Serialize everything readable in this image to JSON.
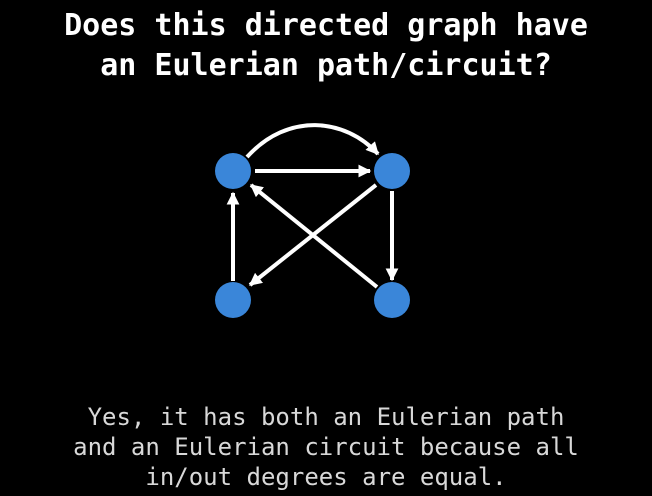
{
  "question": {
    "line1": "Does this directed graph have",
    "line2": "an Eulerian path/circuit?"
  },
  "graph": {
    "node_color": "#3a86d9",
    "edge_color": "#ffffff",
    "nodes": [
      "top-left",
      "top-right",
      "bottom-left",
      "bottom-right"
    ],
    "edges": [
      {
        "from": "top-left",
        "to": "top-right",
        "style": "curved"
      },
      {
        "from": "top-left",
        "to": "top-right",
        "style": "straight"
      },
      {
        "from": "bottom-left",
        "to": "top-left",
        "style": "straight"
      },
      {
        "from": "top-right",
        "to": "bottom-right",
        "style": "straight"
      },
      {
        "from": "top-right",
        "to": "bottom-left",
        "style": "straight"
      },
      {
        "from": "bottom-right",
        "to": "top-left",
        "style": "straight"
      }
    ]
  },
  "answer": {
    "line1": "Yes, it has both an Eulerian path",
    "line2": "and an Eulerian circuit because all",
    "line3": "in/out degrees are equal."
  }
}
